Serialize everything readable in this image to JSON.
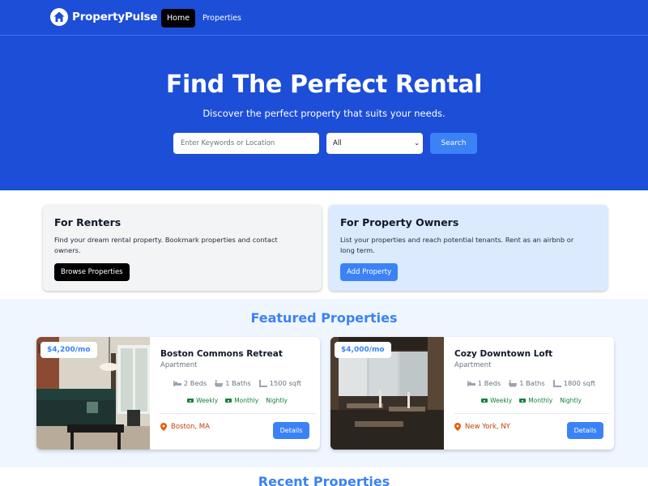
{
  "nav": {
    "brand": "PropertyPulse",
    "home_label": "Home",
    "properties_label": "Properties"
  },
  "hero": {
    "title": "Find The Perfect Rental",
    "subtitle": "Discover the perfect property that suits your needs.",
    "search_placeholder": "Enter Keywords or Location",
    "type_selected": "All",
    "search_button": "Search"
  },
  "info_cards": {
    "renters": {
      "title": "For Renters",
      "text": "Find your dream rental property. Bookmark properties and contact owners.",
      "button": "Browse Properties"
    },
    "owners": {
      "title": "For Property Owners",
      "text": "List your properties and reach potential tenants. Rent as an airbnb or long term.",
      "button": "Add Property"
    }
  },
  "featured": {
    "heading": "Featured Properties",
    "properties": [
      {
        "rate": "$4,200/mo",
        "name": "Boston Commons Retreat",
        "type": "Apartment",
        "beds": "2 Beds",
        "baths": "1 Baths",
        "sqft": "1500 sqft",
        "rates": [
          "Weekly",
          "Monthly",
          "Nightly"
        ],
        "location": "Boston, MA",
        "details_button": "Details"
      },
      {
        "rate": "$4,000/mo",
        "name": "Cozy Downtown Loft",
        "type": "Apartment",
        "beds": "1 Beds",
        "baths": "1 Baths",
        "sqft": "1800 sqft",
        "rates": [
          "Weekly",
          "Monthly",
          "Nightly"
        ],
        "location": "New York, NY",
        "details_button": "Details"
      }
    ]
  },
  "recent": {
    "heading": "Recent Properties"
  },
  "colors": {
    "primary": "#1d4ed8",
    "accent": "#3b82f6",
    "renters_card_bg": "#f3f4f6",
    "owners_card_bg": "#dbeafe",
    "rate_green": "#15803d",
    "location_orange": "#c2410c"
  }
}
